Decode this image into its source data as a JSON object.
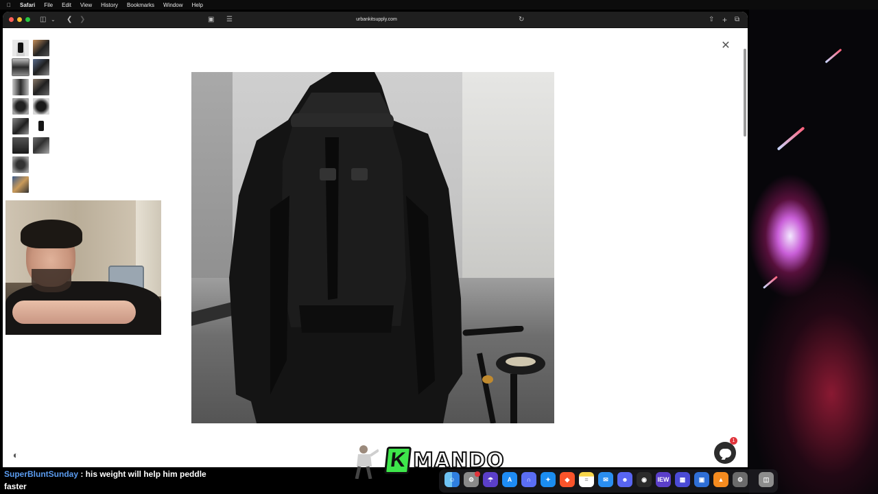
{
  "menubar": {
    "app": "Safari",
    "items": [
      "File",
      "Edit",
      "View",
      "History",
      "Bookmarks",
      "Window",
      "Help"
    ]
  },
  "browser": {
    "url": "urbankitsupply.com"
  },
  "page": {
    "thumbnail_count": 14,
    "chat_badge_count": "1"
  },
  "stream": {
    "chat_user": "SuperBluntSunday",
    "chat_message": " : his weight will help him peddle",
    "chat_message_cont": "faster",
    "logo_letter": "K",
    "logo_text": "MANDO"
  },
  "dock": {
    "icons": [
      "finder-icon",
      "launchpad-icon",
      "proton-vpn-icon",
      "app-store-icon",
      "arc-browser-icon",
      "safari-icon",
      "brave-icon",
      "notes-icon",
      "mail-icon",
      "discord-icon",
      "obs-icon",
      "iew-icon",
      "grid-app-icon",
      "capture-icon",
      "vlc-icon",
      "settings-icon",
      "trash-icon"
    ],
    "iew_label": "IEW"
  },
  "colors": {
    "chat_username": "#5b9cf0",
    "logo_green": "#3ee64b",
    "badge_red": "#e0343b"
  }
}
